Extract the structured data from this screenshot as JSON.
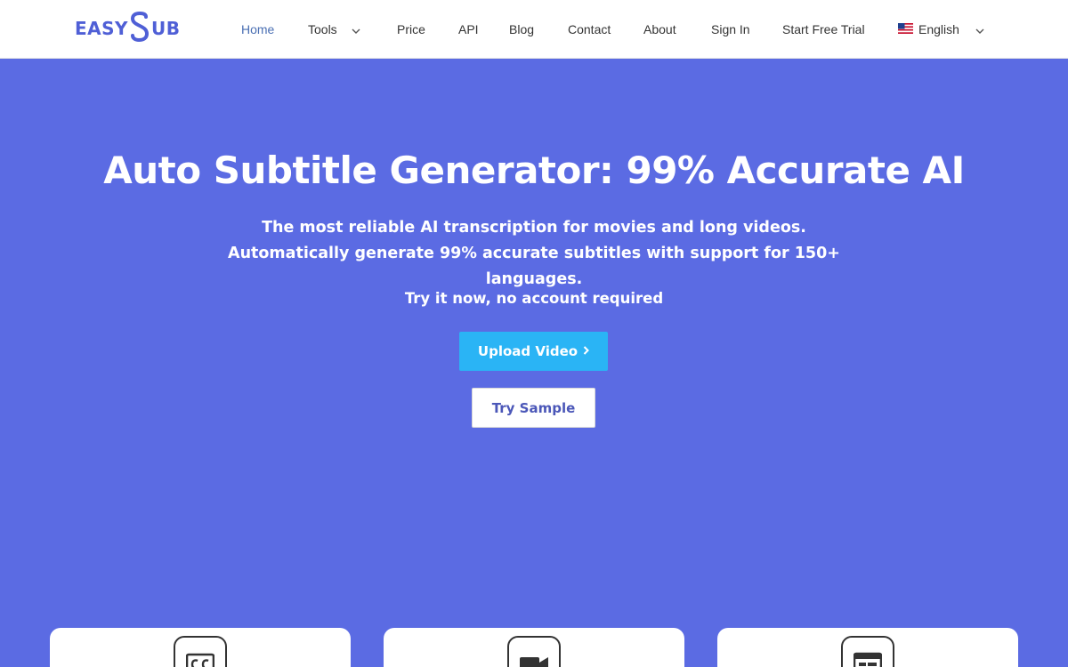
{
  "brand": {
    "logo_prefix": "EASY",
    "logo_mark": "S",
    "logo_suffix": "UB",
    "color": "#4f5fd6"
  },
  "nav": {
    "items": [
      {
        "label": "Home",
        "active": true
      },
      {
        "label": "Tools",
        "has_dropdown": true
      },
      {
        "label": "Price"
      },
      {
        "label": "API"
      },
      {
        "label": "Blog"
      },
      {
        "label": "Contact"
      },
      {
        "label": "About"
      },
      {
        "label": "Sign In"
      },
      {
        "label": "Start Free Trial"
      }
    ],
    "language": {
      "label": "English",
      "icon": "us-flag-icon",
      "has_dropdown": true
    }
  },
  "hero": {
    "title": "Auto Subtitle Generator: 99% Accurate AI",
    "subtitle": "The most reliable AI transcription for movies and long videos. Automatically generate 99% accurate subtitles with support for 150+ languages.",
    "try_note": "Try it now, no account required",
    "upload_label": "Upload Video",
    "upload_icon": "chevron-right-icon",
    "sample_label": "Try Sample",
    "background": "#5b6be3",
    "upload_color": "#2ab4f5"
  },
  "feature_cards": [
    {
      "icon": "closed-caption-icon"
    },
    {
      "icon": "video-camera-icon"
    },
    {
      "icon": "browser-window-icon"
    }
  ]
}
